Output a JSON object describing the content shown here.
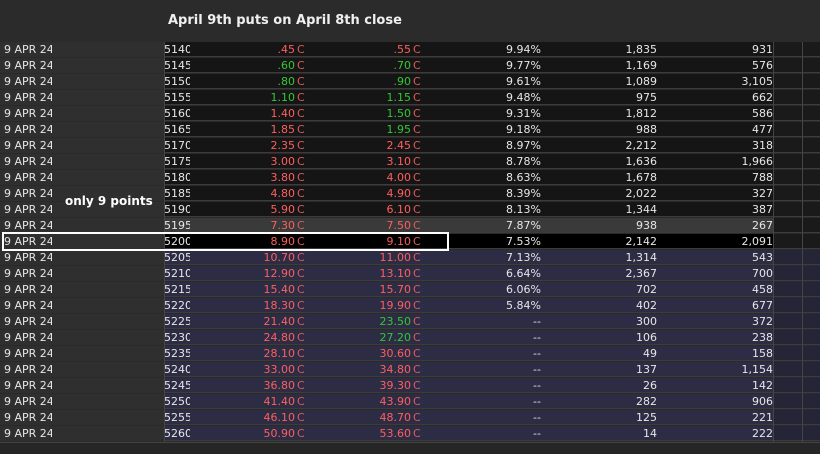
{
  "title": "April 9th puts on April 8th close",
  "annotation": "only 9 points",
  "selected_strike": "5200",
  "colors": {
    "down": "#ff5f5f",
    "up": "#35c735",
    "otm_band": "#2c2c44",
    "highlight_border": "#ffffff"
  },
  "rows": [
    {
      "date": "9 APR 24",
      "strike": "5140",
      "bid": ".45",
      "bid_flag": "C",
      "ask": ".55",
      "ask_flag": "C",
      "iv": "9.94%",
      "vol": "1,835",
      "oi": "931",
      "bid_dir": "down",
      "ask_dir": "down",
      "band": "dark"
    },
    {
      "date": "9 APR 24",
      "strike": "5145",
      "bid": ".60",
      "bid_flag": "C",
      "ask": ".70",
      "ask_flag": "C",
      "iv": "9.77%",
      "vol": "1,169",
      "oi": "576",
      "bid_dir": "up",
      "ask_dir": "up",
      "band": "dark"
    },
    {
      "date": "9 APR 24",
      "strike": "5150",
      "bid": ".80",
      "bid_flag": "C",
      "ask": ".90",
      "ask_flag": "C",
      "iv": "9.61%",
      "vol": "1,089",
      "oi": "3,105",
      "bid_dir": "up",
      "ask_dir": "up",
      "band": "dark"
    },
    {
      "date": "9 APR 24",
      "strike": "5155",
      "bid": "1.10",
      "bid_flag": "C",
      "ask": "1.15",
      "ask_flag": "C",
      "iv": "9.48%",
      "vol": "975",
      "oi": "662",
      "bid_dir": "up",
      "ask_dir": "up",
      "band": "dark"
    },
    {
      "date": "9 APR 24",
      "strike": "5160",
      "bid": "1.40",
      "bid_flag": "C",
      "ask": "1.50",
      "ask_flag": "C",
      "iv": "9.31%",
      "vol": "1,812",
      "oi": "586",
      "bid_dir": "down",
      "ask_dir": "up",
      "band": "dark"
    },
    {
      "date": "9 APR 24",
      "strike": "5165",
      "bid": "1.85",
      "bid_flag": "C",
      "ask": "1.95",
      "ask_flag": "C",
      "iv": "9.18%",
      "vol": "988",
      "oi": "477",
      "bid_dir": "down",
      "ask_dir": "up",
      "band": "dark"
    },
    {
      "date": "9 APR 24",
      "strike": "5170",
      "bid": "2.35",
      "bid_flag": "C",
      "ask": "2.45",
      "ask_flag": "C",
      "iv": "8.97%",
      "vol": "2,212",
      "oi": "318",
      "bid_dir": "down",
      "ask_dir": "down",
      "band": "dark"
    },
    {
      "date": "9 APR 24",
      "strike": "5175",
      "bid": "3.00",
      "bid_flag": "C",
      "ask": "3.10",
      "ask_flag": "C",
      "iv": "8.78%",
      "vol": "1,636",
      "oi": "1,966",
      "bid_dir": "down",
      "ask_dir": "down",
      "band": "dark"
    },
    {
      "date": "9 APR 24",
      "strike": "5180",
      "bid": "3.80",
      "bid_flag": "C",
      "ask": "4.00",
      "ask_flag": "C",
      "iv": "8.63%",
      "vol": "1,678",
      "oi": "788",
      "bid_dir": "down",
      "ask_dir": "down",
      "band": "dark"
    },
    {
      "date": "9 APR 24",
      "strike": "5185",
      "bid": "4.80",
      "bid_flag": "C",
      "ask": "4.90",
      "ask_flag": "C",
      "iv": "8.39%",
      "vol": "2,022",
      "oi": "327",
      "bid_dir": "down",
      "ask_dir": "down",
      "band": "dark"
    },
    {
      "date": "9 APR 24",
      "strike": "5190",
      "bid": "5.90",
      "bid_flag": "C",
      "ask": "6.10",
      "ask_flag": "C",
      "iv": "8.13%",
      "vol": "1,344",
      "oi": "387",
      "bid_dir": "down",
      "ask_dir": "down",
      "band": "dark"
    },
    {
      "date": "9 APR 24",
      "strike": "5195",
      "bid": "7.30",
      "bid_flag": "C",
      "ask": "7.50",
      "ask_flag": "C",
      "iv": "7.87%",
      "vol": "938",
      "oi": "267",
      "bid_dir": "down",
      "ask_dir": "down",
      "band": "hi"
    },
    {
      "date": "9 APR 24",
      "strike": "5200",
      "bid": "8.90",
      "bid_flag": "C",
      "ask": "9.10",
      "ask_flag": "C",
      "iv": "7.53%",
      "vol": "2,142",
      "oi": "2,091",
      "bid_dir": "down",
      "ask_dir": "down",
      "band": "sel"
    },
    {
      "date": "9 APR 24",
      "strike": "5205",
      "bid": "10.70",
      "bid_flag": "C",
      "ask": "11.00",
      "ask_flag": "C",
      "iv": "7.13%",
      "vol": "1,314",
      "oi": "543",
      "bid_dir": "down",
      "ask_dir": "down",
      "band": "blue"
    },
    {
      "date": "9 APR 24",
      "strike": "5210",
      "bid": "12.90",
      "bid_flag": "C",
      "ask": "13.10",
      "ask_flag": "C",
      "iv": "6.64%",
      "vol": "2,367",
      "oi": "700",
      "bid_dir": "down",
      "ask_dir": "down",
      "band": "blue"
    },
    {
      "date": "9 APR 24",
      "strike": "5215",
      "bid": "15.40",
      "bid_flag": "C",
      "ask": "15.70",
      "ask_flag": "C",
      "iv": "6.06%",
      "vol": "702",
      "oi": "458",
      "bid_dir": "down",
      "ask_dir": "down",
      "band": "blue"
    },
    {
      "date": "9 APR 24",
      "strike": "5220",
      "bid": "18.30",
      "bid_flag": "C",
      "ask": "19.90",
      "ask_flag": "C",
      "iv": "5.84%",
      "vol": "402",
      "oi": "677",
      "bid_dir": "down",
      "ask_dir": "down",
      "band": "blue"
    },
    {
      "date": "9 APR 24",
      "strike": "5225",
      "bid": "21.40",
      "bid_flag": "C",
      "ask": "23.50",
      "ask_flag": "C",
      "iv": "--",
      "vol": "300",
      "oi": "372",
      "bid_dir": "down",
      "ask_dir": "up",
      "band": "blue"
    },
    {
      "date": "9 APR 24",
      "strike": "5230",
      "bid": "24.80",
      "bid_flag": "C",
      "ask": "27.20",
      "ask_flag": "C",
      "iv": "--",
      "vol": "106",
      "oi": "238",
      "bid_dir": "down",
      "ask_dir": "up",
      "band": "blue"
    },
    {
      "date": "9 APR 24",
      "strike": "5235",
      "bid": "28.10",
      "bid_flag": "C",
      "ask": "30.60",
      "ask_flag": "C",
      "iv": "--",
      "vol": "49",
      "oi": "158",
      "bid_dir": "down",
      "ask_dir": "down",
      "band": "blue"
    },
    {
      "date": "9 APR 24",
      "strike": "5240",
      "bid": "33.00",
      "bid_flag": "C",
      "ask": "34.80",
      "ask_flag": "C",
      "iv": "--",
      "vol": "137",
      "oi": "1,154",
      "bid_dir": "down",
      "ask_dir": "down",
      "band": "blue"
    },
    {
      "date": "9 APR 24",
      "strike": "5245",
      "bid": "36.80",
      "bid_flag": "C",
      "ask": "39.30",
      "ask_flag": "C",
      "iv": "--",
      "vol": "26",
      "oi": "142",
      "bid_dir": "down",
      "ask_dir": "down",
      "band": "blue"
    },
    {
      "date": "9 APR 24",
      "strike": "5250",
      "bid": "41.40",
      "bid_flag": "C",
      "ask": "43.90",
      "ask_flag": "C",
      "iv": "--",
      "vol": "282",
      "oi": "906",
      "bid_dir": "down",
      "ask_dir": "down",
      "band": "blue"
    },
    {
      "date": "9 APR 24",
      "strike": "5255",
      "bid": "46.10",
      "bid_flag": "C",
      "ask": "48.70",
      "ask_flag": "C",
      "iv": "--",
      "vol": "125",
      "oi": "221",
      "bid_dir": "down",
      "ask_dir": "down",
      "band": "blue"
    },
    {
      "date": "9 APR 24",
      "strike": "5260",
      "bid": "50.90",
      "bid_flag": "C",
      "ask": "53.60",
      "ask_flag": "C",
      "iv": "--",
      "vol": "14",
      "oi": "222",
      "bid_dir": "down",
      "ask_dir": "down",
      "band": "blue"
    }
  ]
}
